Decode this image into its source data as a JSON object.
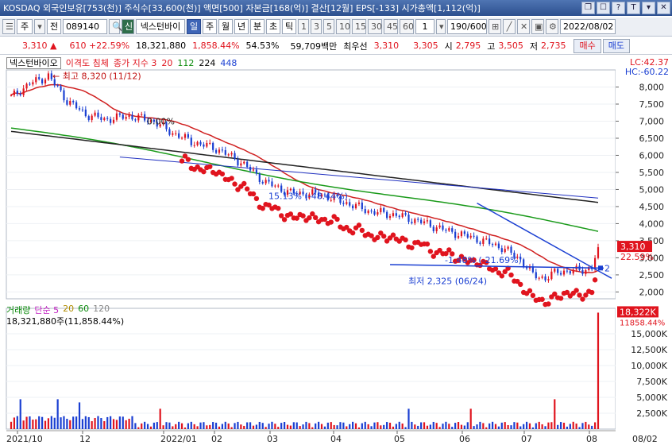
{
  "titlebar": {
    "text": "KOSDAQ 외국인보유[753(천)] 주식수[33,600(천)] 액면[500] 자본금[168(억)] 결산[12월] EPS[-133] 시가총액[1,112(억)]",
    "btn_restore": "❐",
    "btn_max": "☐",
    "btn_help": "?",
    "btn_pin": "T",
    "btn_min": "▾",
    "btn_close": "✕"
  },
  "toolbar": {
    "market": "주",
    "market_menu": "▾",
    "all": "전",
    "code": "089140",
    "sin": "신",
    "name": "넥스턴바이",
    "periods": [
      "일",
      "주",
      "월",
      "년",
      "분",
      "초",
      "틱"
    ],
    "minutes": [
      "1",
      "3",
      "5",
      "10",
      "15",
      "30",
      "45",
      "60"
    ],
    "count_input": "1",
    "count_value": "190/600",
    "date": "2022/08/02"
  },
  "price": {
    "current": "3,310 ▲",
    "change": "610 +22.59%",
    "volume": "18,321,880",
    "amount": "1,858.44%",
    "turnover": "54.53%",
    "value": "59,709백만",
    "best_label": "최우선",
    "best_ask": "3,310",
    "best_bid": "3,305",
    "open_label": "시",
    "open": "2,795",
    "high_label": "고",
    "high": "3,505",
    "low_label": "저",
    "low": "2,735",
    "buy": "매수",
    "sell": "매도"
  },
  "legend": {
    "stock": "넥스턴바이오",
    "disparity": "이격도 침체",
    "ma_title": "종가 지수 3",
    "ma1": "20",
    "ma2": "112",
    "ma3": "224",
    "ma4": "448",
    "lc": "LC:42.37",
    "hc": "HC:-60.22"
  },
  "annotations": {
    "max": "최고 8,320 (11/12)",
    "min": "최저 2,325 (06/24)",
    "trend1": "15.13% (-48.44%)",
    "trend2": "-1.48% (-21.69%)",
    "flat": "0.00%",
    "price_tag": "3,310",
    "pct_tag": "22.59%",
    "line_label": "2"
  },
  "volume_panel": {
    "title": "거래량",
    "ma_title": "단순 5",
    "ma2": "20",
    "ma3": "60",
    "ma4": "120",
    "summary": "18,321,880주(11,858.44%)",
    "tag": "18,322K",
    "tag_pct": "11858.44%"
  },
  "axes": {
    "price_ticks": [
      "8,000",
      "7,500",
      "7,000",
      "6,500",
      "6,000",
      "5,500",
      "5,000",
      "4,500",
      "4,000",
      "3,500",
      "3,000",
      "2,500",
      "2,000"
    ],
    "vol_ticks": [
      "15,000K",
      "12,500K",
      "10,000K",
      "7,500K",
      "5,000K",
      "2,500K"
    ],
    "date_labels": [
      "2021/10",
      "12",
      "2022/01",
      "02",
      "03",
      "04",
      "05",
      "06",
      "07",
      "08"
    ],
    "date_right": "08/02"
  },
  "colors": {
    "up": "#e0141e",
    "down": "#1a3fd2",
    "ma20": "#d02020",
    "ma112": "#1a9a1a",
    "ma224": "#222222",
    "ma448": "#2030c0",
    "disparity": "#e0141e"
  }
}
